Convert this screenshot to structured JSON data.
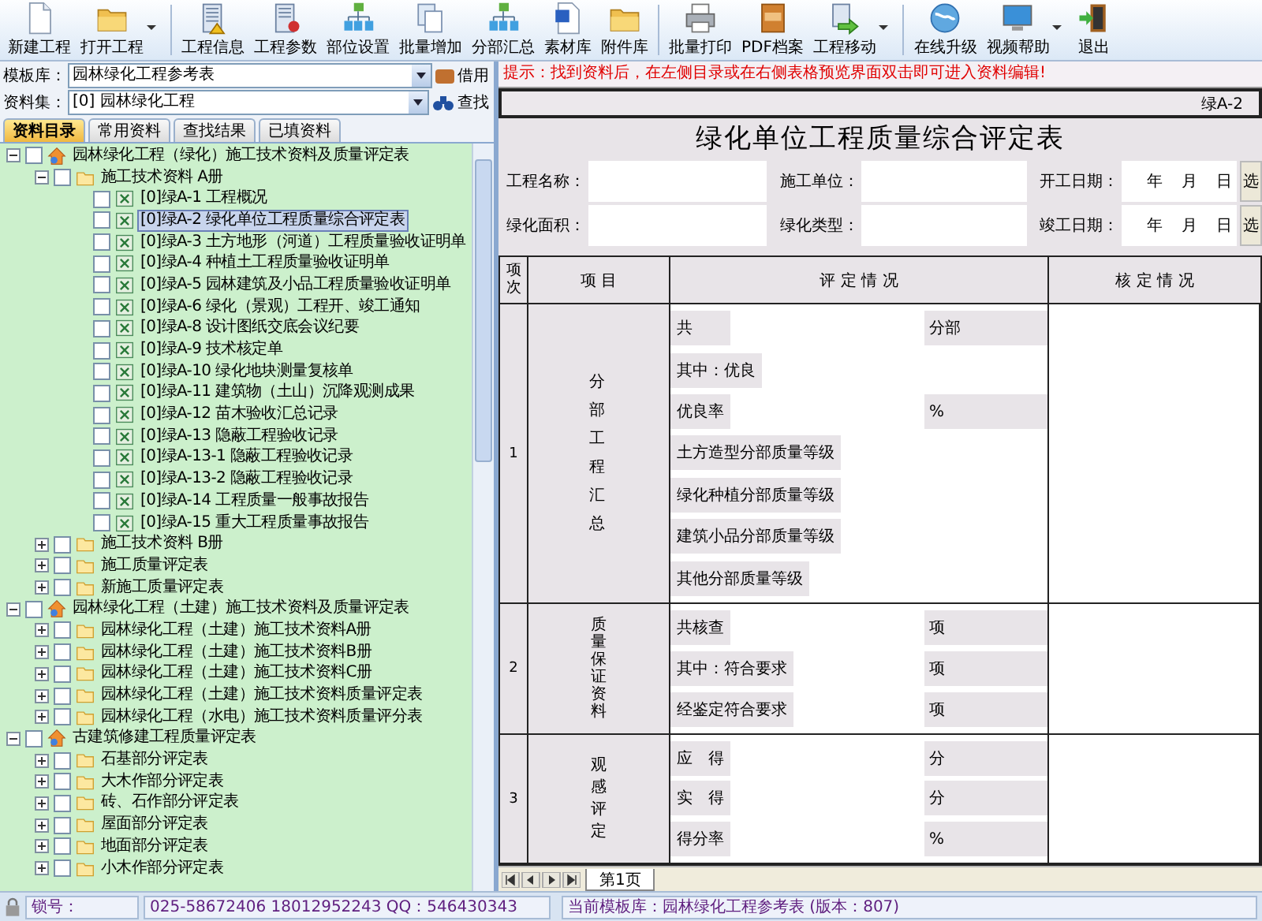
{
  "toolbar": [
    [
      {
        "label": "新建工程",
        "kind": "doc",
        "menu": false
      },
      {
        "label": "打开工程",
        "kind": "folder",
        "menu": true
      }
    ],
    [
      {
        "label": "工程信息",
        "kind": "building",
        "menu": false
      },
      {
        "label": "工程参数",
        "kind": "params",
        "menu": false
      },
      {
        "label": "部位设置",
        "kind": "org",
        "menu": false
      },
      {
        "label": "批量增加",
        "kind": "pages",
        "menu": false
      },
      {
        "label": "分部汇总",
        "kind": "org",
        "menu": false
      },
      {
        "label": "素材库",
        "kind": "word",
        "menu": false
      },
      {
        "label": "附件库",
        "kind": "folder",
        "menu": false
      }
    ],
    [
      {
        "label": "批量打印",
        "kind": "printer",
        "menu": false
      },
      {
        "label": "PDF档案",
        "kind": "pdf",
        "menu": false
      },
      {
        "label": "工程移动",
        "kind": "move",
        "menu": true
      }
    ],
    [
      {
        "label": "在线升级",
        "kind": "globe",
        "menu": false
      },
      {
        "label": "视频帮助",
        "kind": "monitor",
        "menu": true
      },
      {
        "label": "退出",
        "kind": "exit",
        "menu": false
      }
    ]
  ],
  "template_library": {
    "label": "模板库：",
    "value": "园林绿化工程参考表",
    "button": "借用"
  },
  "dataset": {
    "label": "资料集：",
    "value": "[0] 园林绿化工程",
    "button": "查找"
  },
  "tabs": [
    {
      "label": "资料目录",
      "selected": true
    },
    {
      "label": "常用资料",
      "selected": false
    },
    {
      "label": "查找结果",
      "selected": false
    },
    {
      "label": "已填资料",
      "selected": false
    }
  ],
  "tree": [
    {
      "kind": "root",
      "label": "园林绿化工程（绿化）施工技术资料及质量评定表",
      "checked": false,
      "selected": false,
      "expanded": true,
      "children": [
        {
          "kind": "folder",
          "label": "施工技术资料 A册",
          "checked": false,
          "selected": false,
          "expanded": true,
          "children": [
            {
              "kind": "doc",
              "label": "[0]绿A-1 工程概况",
              "checked": false,
              "selected": false
            },
            {
              "kind": "doc",
              "label": "[0]绿A-2 绿化单位工程质量综合评定表",
              "checked": false,
              "selected": true
            },
            {
              "kind": "doc",
              "label": "[0]绿A-3 土方地形（河道）工程质量验收证明单",
              "checked": false,
              "selected": false
            },
            {
              "kind": "doc",
              "label": "[0]绿A-4 种植土工程质量验收证明单",
              "checked": false,
              "selected": false
            },
            {
              "kind": "doc",
              "label": "[0]绿A-5 园林建筑及小品工程质量验收证明单",
              "checked": false,
              "selected": false
            },
            {
              "kind": "doc",
              "label": "[0]绿A-6 绿化（景观）工程开、竣工通知",
              "checked": false,
              "selected": false
            },
            {
              "kind": "doc",
              "label": "[0]绿A-8 设计图纸交底会议纪要",
              "checked": false,
              "selected": false
            },
            {
              "kind": "doc",
              "label": "[0]绿A-9 技术核定单",
              "checked": false,
              "selected": false
            },
            {
              "kind": "doc",
              "label": "[0]绿A-10 绿化地块测量复核单",
              "checked": false,
              "selected": false
            },
            {
              "kind": "doc",
              "label": "[0]绿A-11 建筑物（土山）沉降观测成果",
              "checked": false,
              "selected": false
            },
            {
              "kind": "doc",
              "label": "[0]绿A-12 苗木验收汇总记录",
              "checked": false,
              "selected": false
            },
            {
              "kind": "doc",
              "label": "[0]绿A-13 隐蔽工程验收记录",
              "checked": false,
              "selected": false
            },
            {
              "kind": "doc",
              "label": "[0]绿A-13-1 隐蔽工程验收记录",
              "checked": false,
              "selected": false
            },
            {
              "kind": "doc",
              "label": "[0]绿A-13-2 隐蔽工程验收记录",
              "checked": false,
              "selected": false
            },
            {
              "kind": "doc",
              "label": "[0]绿A-14 工程质量一般事故报告",
              "checked": false,
              "selected": false
            },
            {
              "kind": "doc",
              "label": "[0]绿A-15 重大工程质量事故报告",
              "checked": false,
              "selected": false
            }
          ]
        },
        {
          "kind": "folder",
          "label": "施工技术资料 B册",
          "checked": false,
          "selected": false,
          "expanded": false
        },
        {
          "kind": "folder",
          "label": "施工质量评定表",
          "checked": false,
          "selected": false,
          "expanded": false
        },
        {
          "kind": "folder",
          "label": "新施工质量评定表",
          "checked": false,
          "selected": false,
          "expanded": false
        }
      ]
    },
    {
      "kind": "root",
      "label": "园林绿化工程（土建）施工技术资料及质量评定表",
      "checked": false,
      "selected": false,
      "expanded": true,
      "children": [
        {
          "kind": "folder",
          "label": "园林绿化工程（土建）施工技术资料A册",
          "checked": false,
          "selected": false,
          "expanded": false
        },
        {
          "kind": "folder",
          "label": "园林绿化工程（土建）施工技术资料B册",
          "checked": false,
          "selected": false,
          "expanded": false
        },
        {
          "kind": "folder",
          "label": "园林绿化工程（土建）施工技术资料C册",
          "checked": false,
          "selected": false,
          "expanded": false
        },
        {
          "kind": "folder",
          "label": "园林绿化工程（土建）施工技术资料质量评定表",
          "checked": false,
          "selected": false,
          "expanded": false
        },
        {
          "kind": "folder",
          "label": "园林绿化工程（水电）施工技术资料质量评分表",
          "checked": false,
          "selected": false,
          "expanded": false
        }
      ]
    },
    {
      "kind": "root",
      "label": "古建筑修建工程质量评定表",
      "checked": false,
      "selected": false,
      "expanded": true,
      "children": [
        {
          "kind": "folder",
          "label": "石基部分评定表",
          "checked": false,
          "selected": false,
          "expanded": false
        },
        {
          "kind": "folder",
          "label": "大木作部分评定表",
          "checked": false,
          "selected": false,
          "expanded": false
        },
        {
          "kind": "folder",
          "label": "砖、石作部分评定表",
          "checked": false,
          "selected": false,
          "expanded": false
        },
        {
          "kind": "folder",
          "label": "屋面部分评定表",
          "checked": false,
          "selected": false,
          "expanded": false
        },
        {
          "kind": "folder",
          "label": "地面部分评定表",
          "checked": false,
          "selected": false,
          "expanded": false
        },
        {
          "kind": "folder",
          "label": "小木作部分评定表",
          "checked": false,
          "selected": false,
          "expanded": false
        }
      ]
    }
  ],
  "hint": "提示：找到资料后，在左侧目录或在右侧表格预览界面双击即可进入资料编辑!",
  "form": {
    "code": "绿A-2",
    "title": "绿化单位工程质量综合评定表",
    "field_rows": [
      [
        {
          "label": "工程名称：",
          "kind": "text"
        },
        {
          "label": "施工单位：",
          "kind": "text"
        },
        {
          "label": "开工日期：",
          "kind": "date",
          "parts": [
            "年",
            "月",
            "日"
          ],
          "button": "选"
        }
      ],
      [
        {
          "label": "绿化面积：",
          "kind": "text"
        },
        {
          "label": "绿化类型：",
          "kind": "text"
        },
        {
          "label": "竣工日期：",
          "kind": "date",
          "parts": [
            "年",
            "月",
            "日"
          ],
          "button": "选"
        }
      ]
    ],
    "columns": [
      "项次",
      "项 目",
      "评 定 情 况",
      "核 定 情 况"
    ],
    "sections": [
      {
        "number": "1",
        "item": "分部工程汇总",
        "lines": [
          {
            "label": "共",
            "unit": "分部"
          },
          {
            "label": "其中：优良"
          },
          {
            "label": "优良率",
            "unit": "%"
          },
          {
            "label": "土方造型分部质量等级"
          },
          {
            "label": "绿化种植分部质量等级"
          },
          {
            "label": "建筑小品分部质量等级"
          },
          {
            "label": "其他分部质量等级"
          }
        ]
      },
      {
        "number": "2",
        "item": "质量保证资料",
        "lines": [
          {
            "label": "共核查",
            "unit": "项"
          },
          {
            "label": "其中：符合要求",
            "unit": "项"
          },
          {
            "label": "经鉴定符合要求",
            "unit": "项"
          }
        ]
      },
      {
        "number": "3",
        "item": "观感评定",
        "lines": [
          {
            "label": "应　得",
            "unit": "分"
          },
          {
            "label": "实　得",
            "unit": "分"
          },
          {
            "label": "得分率",
            "unit": "%"
          }
        ]
      }
    ]
  },
  "page_tabs": [
    {
      "label": "第1页",
      "selected": true
    }
  ],
  "status_bar": {
    "lock_label": "锁号：",
    "contact": "025-58672406 18012952243  QQ：546430343",
    "template": "当前模板库：园林绿化工程参考表 (版本：807)"
  }
}
